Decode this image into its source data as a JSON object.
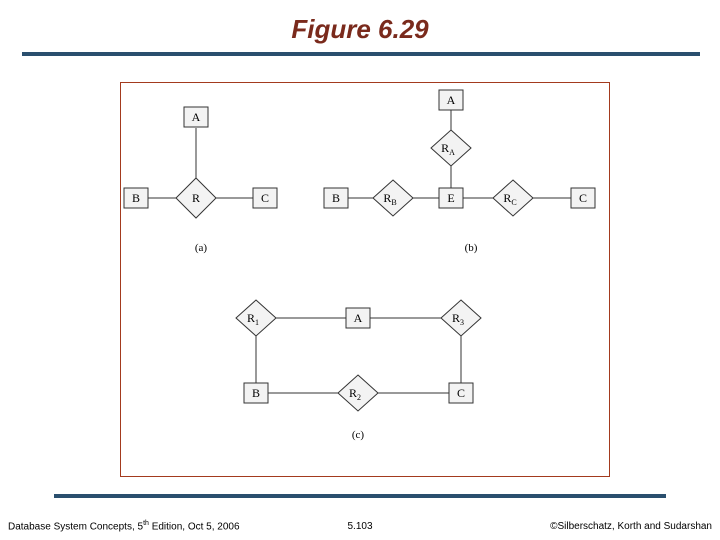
{
  "title": "Figure 6.29",
  "footer": {
    "left_prefix": "Database System Concepts, 5",
    "left_sup": "th",
    "left_suffix": " Edition, Oct 5, 2006",
    "center": "5.103",
    "right": "©Silberschatz, Korth and Sudarshan"
  },
  "diagrams": {
    "a": {
      "caption": "(a)",
      "entities": {
        "A": "A",
        "B": "B",
        "C": "C"
      },
      "relationship": "R"
    },
    "b": {
      "caption": "(b)",
      "entities": {
        "A": "A",
        "B": "B",
        "E": "E",
        "C": "C"
      },
      "relationships": {
        "RA": "R",
        "RA_sub": "A",
        "RB": "R",
        "RB_sub": "B",
        "RC": "R",
        "RC_sub": "C"
      }
    },
    "c": {
      "caption": "(c)",
      "entities": {
        "A": "A",
        "B": "B",
        "C": "C"
      },
      "relationships": {
        "R1": "R",
        "R1_sub": "1",
        "R2": "R",
        "R2_sub": "2",
        "R3": "R",
        "R3_sub": "3"
      }
    }
  }
}
